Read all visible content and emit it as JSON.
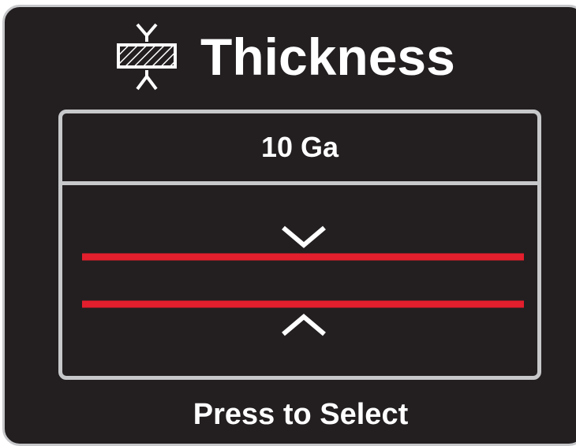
{
  "header": {
    "icon": "thickness-gauge-icon",
    "title": "Thickness"
  },
  "selection": {
    "value": "10 Ga"
  },
  "gap_graphic": {
    "line_color": "#e31e2d",
    "chevron_color": "#ffffff"
  },
  "footer": {
    "prompt": "Press to Select"
  },
  "colors": {
    "background": "#231f20",
    "border": "#c7c8ca",
    "text": "#ffffff"
  }
}
